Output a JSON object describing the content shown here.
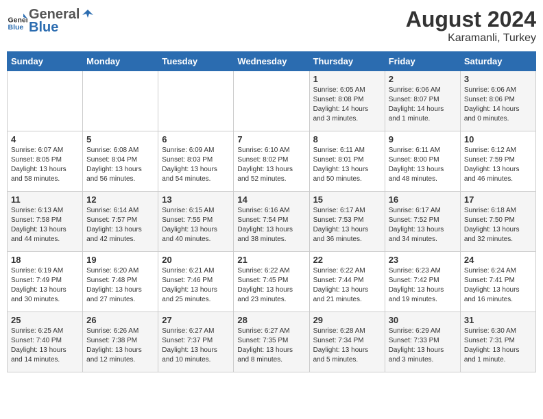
{
  "header": {
    "logo_general": "General",
    "logo_blue": "Blue",
    "month_year": "August 2024",
    "location": "Karamanli, Turkey"
  },
  "days_of_week": [
    "Sunday",
    "Monday",
    "Tuesday",
    "Wednesday",
    "Thursday",
    "Friday",
    "Saturday"
  ],
  "weeks": [
    {
      "days": [
        {
          "num": "",
          "info": ""
        },
        {
          "num": "",
          "info": ""
        },
        {
          "num": "",
          "info": ""
        },
        {
          "num": "",
          "info": ""
        },
        {
          "num": "1",
          "info": "Sunrise: 6:05 AM\nSunset: 8:08 PM\nDaylight: 14 hours\nand 3 minutes."
        },
        {
          "num": "2",
          "info": "Sunrise: 6:06 AM\nSunset: 8:07 PM\nDaylight: 14 hours\nand 1 minute."
        },
        {
          "num": "3",
          "info": "Sunrise: 6:06 AM\nSunset: 8:06 PM\nDaylight: 14 hours\nand 0 minutes."
        }
      ]
    },
    {
      "days": [
        {
          "num": "4",
          "info": "Sunrise: 6:07 AM\nSunset: 8:05 PM\nDaylight: 13 hours\nand 58 minutes."
        },
        {
          "num": "5",
          "info": "Sunrise: 6:08 AM\nSunset: 8:04 PM\nDaylight: 13 hours\nand 56 minutes."
        },
        {
          "num": "6",
          "info": "Sunrise: 6:09 AM\nSunset: 8:03 PM\nDaylight: 13 hours\nand 54 minutes."
        },
        {
          "num": "7",
          "info": "Sunrise: 6:10 AM\nSunset: 8:02 PM\nDaylight: 13 hours\nand 52 minutes."
        },
        {
          "num": "8",
          "info": "Sunrise: 6:11 AM\nSunset: 8:01 PM\nDaylight: 13 hours\nand 50 minutes."
        },
        {
          "num": "9",
          "info": "Sunrise: 6:11 AM\nSunset: 8:00 PM\nDaylight: 13 hours\nand 48 minutes."
        },
        {
          "num": "10",
          "info": "Sunrise: 6:12 AM\nSunset: 7:59 PM\nDaylight: 13 hours\nand 46 minutes."
        }
      ]
    },
    {
      "days": [
        {
          "num": "11",
          "info": "Sunrise: 6:13 AM\nSunset: 7:58 PM\nDaylight: 13 hours\nand 44 minutes."
        },
        {
          "num": "12",
          "info": "Sunrise: 6:14 AM\nSunset: 7:57 PM\nDaylight: 13 hours\nand 42 minutes."
        },
        {
          "num": "13",
          "info": "Sunrise: 6:15 AM\nSunset: 7:55 PM\nDaylight: 13 hours\nand 40 minutes."
        },
        {
          "num": "14",
          "info": "Sunrise: 6:16 AM\nSunset: 7:54 PM\nDaylight: 13 hours\nand 38 minutes."
        },
        {
          "num": "15",
          "info": "Sunrise: 6:17 AM\nSunset: 7:53 PM\nDaylight: 13 hours\nand 36 minutes."
        },
        {
          "num": "16",
          "info": "Sunrise: 6:17 AM\nSunset: 7:52 PM\nDaylight: 13 hours\nand 34 minutes."
        },
        {
          "num": "17",
          "info": "Sunrise: 6:18 AM\nSunset: 7:50 PM\nDaylight: 13 hours\nand 32 minutes."
        }
      ]
    },
    {
      "days": [
        {
          "num": "18",
          "info": "Sunrise: 6:19 AM\nSunset: 7:49 PM\nDaylight: 13 hours\nand 30 minutes."
        },
        {
          "num": "19",
          "info": "Sunrise: 6:20 AM\nSunset: 7:48 PM\nDaylight: 13 hours\nand 27 minutes."
        },
        {
          "num": "20",
          "info": "Sunrise: 6:21 AM\nSunset: 7:46 PM\nDaylight: 13 hours\nand 25 minutes."
        },
        {
          "num": "21",
          "info": "Sunrise: 6:22 AM\nSunset: 7:45 PM\nDaylight: 13 hours\nand 23 minutes."
        },
        {
          "num": "22",
          "info": "Sunrise: 6:22 AM\nSunset: 7:44 PM\nDaylight: 13 hours\nand 21 minutes."
        },
        {
          "num": "23",
          "info": "Sunrise: 6:23 AM\nSunset: 7:42 PM\nDaylight: 13 hours\nand 19 minutes."
        },
        {
          "num": "24",
          "info": "Sunrise: 6:24 AM\nSunset: 7:41 PM\nDaylight: 13 hours\nand 16 minutes."
        }
      ]
    },
    {
      "days": [
        {
          "num": "25",
          "info": "Sunrise: 6:25 AM\nSunset: 7:40 PM\nDaylight: 13 hours\nand 14 minutes."
        },
        {
          "num": "26",
          "info": "Sunrise: 6:26 AM\nSunset: 7:38 PM\nDaylight: 13 hours\nand 12 minutes."
        },
        {
          "num": "27",
          "info": "Sunrise: 6:27 AM\nSunset: 7:37 PM\nDaylight: 13 hours\nand 10 minutes."
        },
        {
          "num": "28",
          "info": "Sunrise: 6:27 AM\nSunset: 7:35 PM\nDaylight: 13 hours\nand 8 minutes."
        },
        {
          "num": "29",
          "info": "Sunrise: 6:28 AM\nSunset: 7:34 PM\nDaylight: 13 hours\nand 5 minutes."
        },
        {
          "num": "30",
          "info": "Sunrise: 6:29 AM\nSunset: 7:33 PM\nDaylight: 13 hours\nand 3 minutes."
        },
        {
          "num": "31",
          "info": "Sunrise: 6:30 AM\nSunset: 7:31 PM\nDaylight: 13 hours\nand 1 minute."
        }
      ]
    }
  ]
}
